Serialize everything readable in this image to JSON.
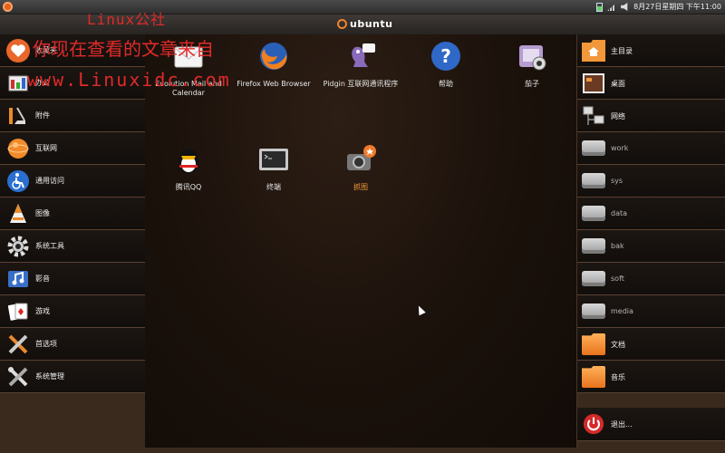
{
  "top_panel": {
    "clock": "8月27日星期四 下午11:00",
    "tray_icons": [
      "battery-icon",
      "signal-icon",
      "volume-icon"
    ]
  },
  "title_bar": {
    "logo_text": "ubuntu"
  },
  "categories": [
    {
      "label": "收藏夹",
      "icon": "heart-icon"
    },
    {
      "label": "办公",
      "icon": "office-icon"
    },
    {
      "label": "附件",
      "icon": "accessories-icon"
    },
    {
      "label": "互联网",
      "icon": "internet-icon"
    },
    {
      "label": "通用访问",
      "icon": "accessibility-icon"
    },
    {
      "label": "图像",
      "icon": "graphics-icon"
    },
    {
      "label": "系统工具",
      "icon": "gear-icon"
    },
    {
      "label": "影音",
      "icon": "music-icon"
    },
    {
      "label": "游戏",
      "icon": "cards-icon"
    },
    {
      "label": "首选项",
      "icon": "preferences-icon"
    },
    {
      "label": "系统管理",
      "icon": "tools-icon"
    }
  ],
  "apps": [
    {
      "label": "Evolution Mail and Calendar",
      "icon": "mail-icon"
    },
    {
      "label": "Firefox Web Browser",
      "icon": "firefox-icon"
    },
    {
      "label": "Pidgin 互联网通讯程序",
      "icon": "pidgin-icon"
    },
    {
      "label": "帮助",
      "icon": "help-icon"
    },
    {
      "label": "茄子",
      "icon": "cheese-icon"
    },
    {
      "label": "腾讯QQ",
      "icon": "qq-icon"
    },
    {
      "label": "终端",
      "icon": "terminal-icon"
    },
    {
      "label": "抓图",
      "icon": "screenshot-icon",
      "selected": true
    }
  ],
  "places": [
    {
      "label": "主目录",
      "icon": "home-folder-icon"
    },
    {
      "label": "桌面",
      "icon": "desktop-icon"
    },
    {
      "label": "网络",
      "icon": "network-icon"
    },
    {
      "label": "work",
      "icon": "hard-drive-icon"
    },
    {
      "label": "sys",
      "icon": "hard-drive-icon"
    },
    {
      "label": "data",
      "icon": "hard-drive-icon"
    },
    {
      "label": "bak",
      "icon": "hard-drive-icon"
    },
    {
      "label": "soft",
      "icon": "hard-drive-icon"
    },
    {
      "label": "media",
      "icon": "hard-drive-icon"
    },
    {
      "label": "文档",
      "icon": "folder-icon"
    },
    {
      "label": "音乐",
      "icon": "folder-icon"
    },
    {
      "label": "退出...",
      "icon": "power-icon"
    }
  ],
  "watermark": {
    "line1": "Linux公社",
    "line2": "你现在查看的文章来自",
    "line3": "www.Linuxidc.com"
  },
  "colors": {
    "accent": "#f39a3a",
    "watermark": "#e02a2a",
    "power": "#d42a2a"
  }
}
